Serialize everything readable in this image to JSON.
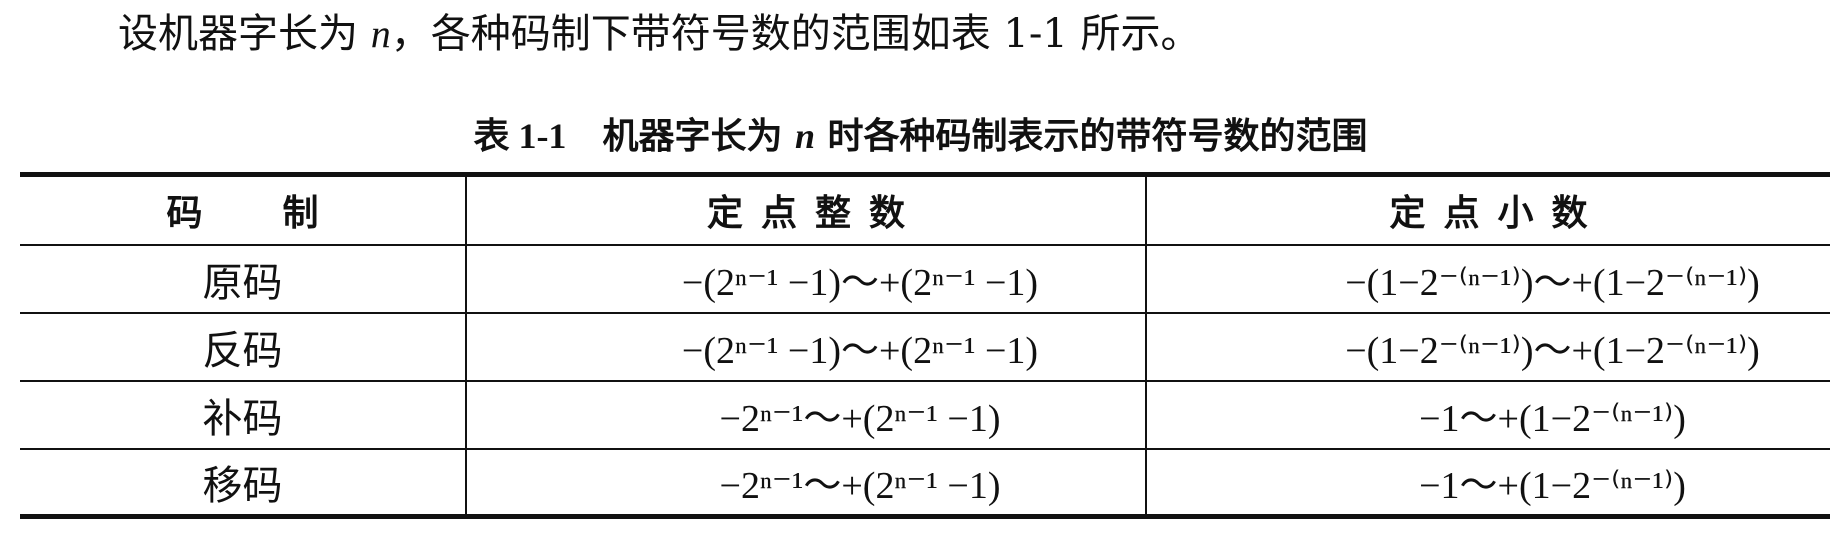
{
  "intro": {
    "text_before": "设机器字长为 ",
    "variable": "n",
    "text_after": "，各种码制下带符号数的范围如表 1-1 所示。"
  },
  "caption": {
    "number": "表 1-1",
    "text_before": "机器字长为 ",
    "variable": "n",
    "text_after": " 时各种码制表示的带符号数的范围"
  },
  "table": {
    "headers": [
      "码制",
      "定点整数",
      "定点小数"
    ],
    "rows": [
      {
        "code": "原码",
        "integer_range": "−(2ⁿ⁻¹ −1)～+(2ⁿ⁻¹ −1)",
        "fraction_range": "−(1−2⁻⁽ⁿ⁻¹⁾)～+(1−2⁻⁽ⁿ⁻¹⁾)"
      },
      {
        "code": "反码",
        "integer_range": "−(2ⁿ⁻¹ −1)～+(2ⁿ⁻¹ −1)",
        "fraction_range": "−(1−2⁻⁽ⁿ⁻¹⁾)～+(1−2⁻⁽ⁿ⁻¹⁾)"
      },
      {
        "code": "补码",
        "integer_range": "−2ⁿ⁻¹～+(2ⁿ⁻¹ −1)",
        "fraction_range": "−1～+(1−2⁻⁽ⁿ⁻¹⁾)"
      },
      {
        "code": "移码",
        "integer_range": "−2ⁿ⁻¹～+(2ⁿ⁻¹ −1)",
        "fraction_range": "−1～+(1−2⁻⁽ⁿ⁻¹⁾)"
      }
    ]
  }
}
